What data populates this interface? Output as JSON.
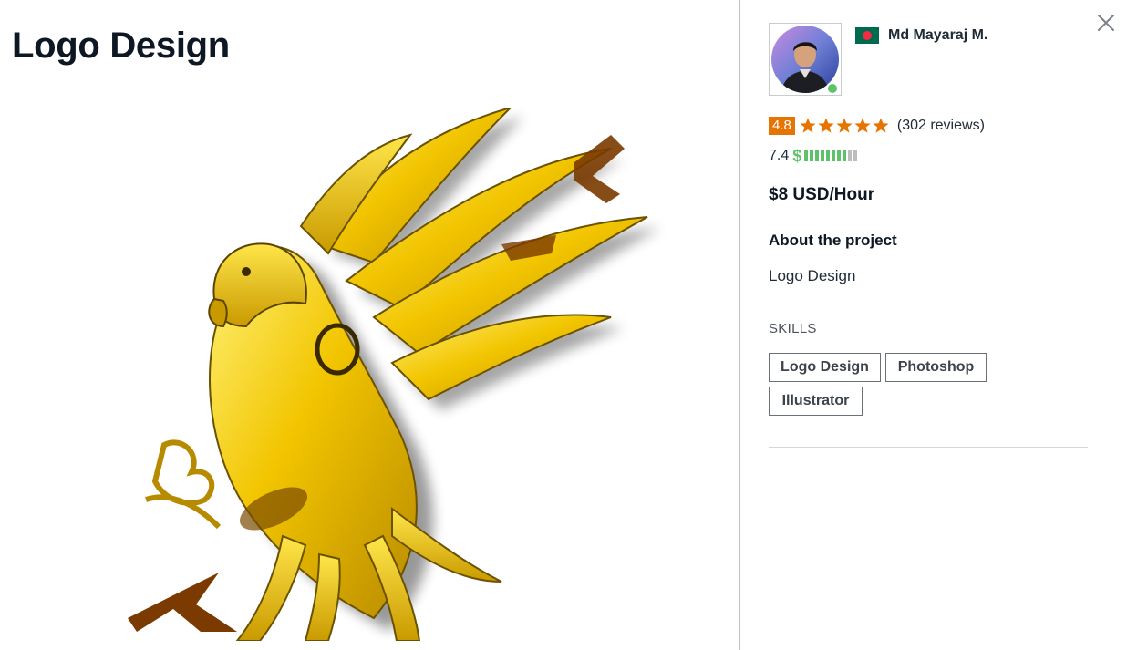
{
  "project": {
    "title": "Logo Design"
  },
  "portfolio": {
    "image_subject": "golden eagle logo artwork"
  },
  "freelancer": {
    "name": "Md Mayaraj M.",
    "country_flag": "bangladesh-flag",
    "online": true,
    "rating": "4.8",
    "stars": 5,
    "reviews": "(302 reviews)",
    "earnings_score": "7.4",
    "earnings_currency_icon": "$",
    "earnings_bars_filled": 8,
    "earnings_bars_total": 10,
    "hourly_rate": "$8 USD/Hour"
  },
  "about": {
    "heading": "About the project",
    "text": "Logo Design"
  },
  "skills": {
    "heading": "SKILLS",
    "items": [
      "Logo Design",
      "Photoshop",
      "Illustrator"
    ]
  },
  "colors": {
    "rating_badge": "#e67400",
    "stars": "#e67400",
    "online": "#5dc26a",
    "earnings": "#5dc26a",
    "text_primary": "#0e1724"
  },
  "icons": {
    "close": "close-icon",
    "star": "star-icon"
  }
}
